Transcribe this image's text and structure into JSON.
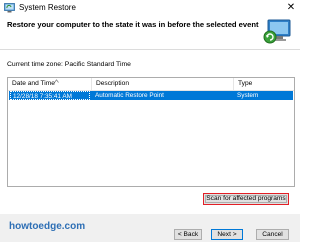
{
  "window": {
    "title": "System Restore",
    "close_glyph": "✕"
  },
  "heading": "Restore your computer to the state it was in before the selected event",
  "timezone_label": "Current time zone: Pacific Standard Time",
  "list": {
    "columns": [
      "Date and Time",
      "Description",
      "Type"
    ],
    "rows": [
      {
        "date": "12/28/18 7:35:41 AM",
        "description": "Automatic Restore Point",
        "type": "System",
        "selected": true
      }
    ]
  },
  "scan_button": {
    "label": "Scan for affected programs",
    "highlight_color": "#e21f26"
  },
  "footer": {
    "watermark": "howtoedge.com",
    "back_label": "< Back",
    "next_label": "Next >",
    "cancel_label": "Cancel"
  },
  "colors": {
    "selection": "#0078d7",
    "watermark": "#2e6fb5"
  },
  "icons": {
    "app": "system-restore-icon",
    "header": "computer-restore-icon",
    "close": "close-icon",
    "sort": "sort-arrow-icon"
  }
}
